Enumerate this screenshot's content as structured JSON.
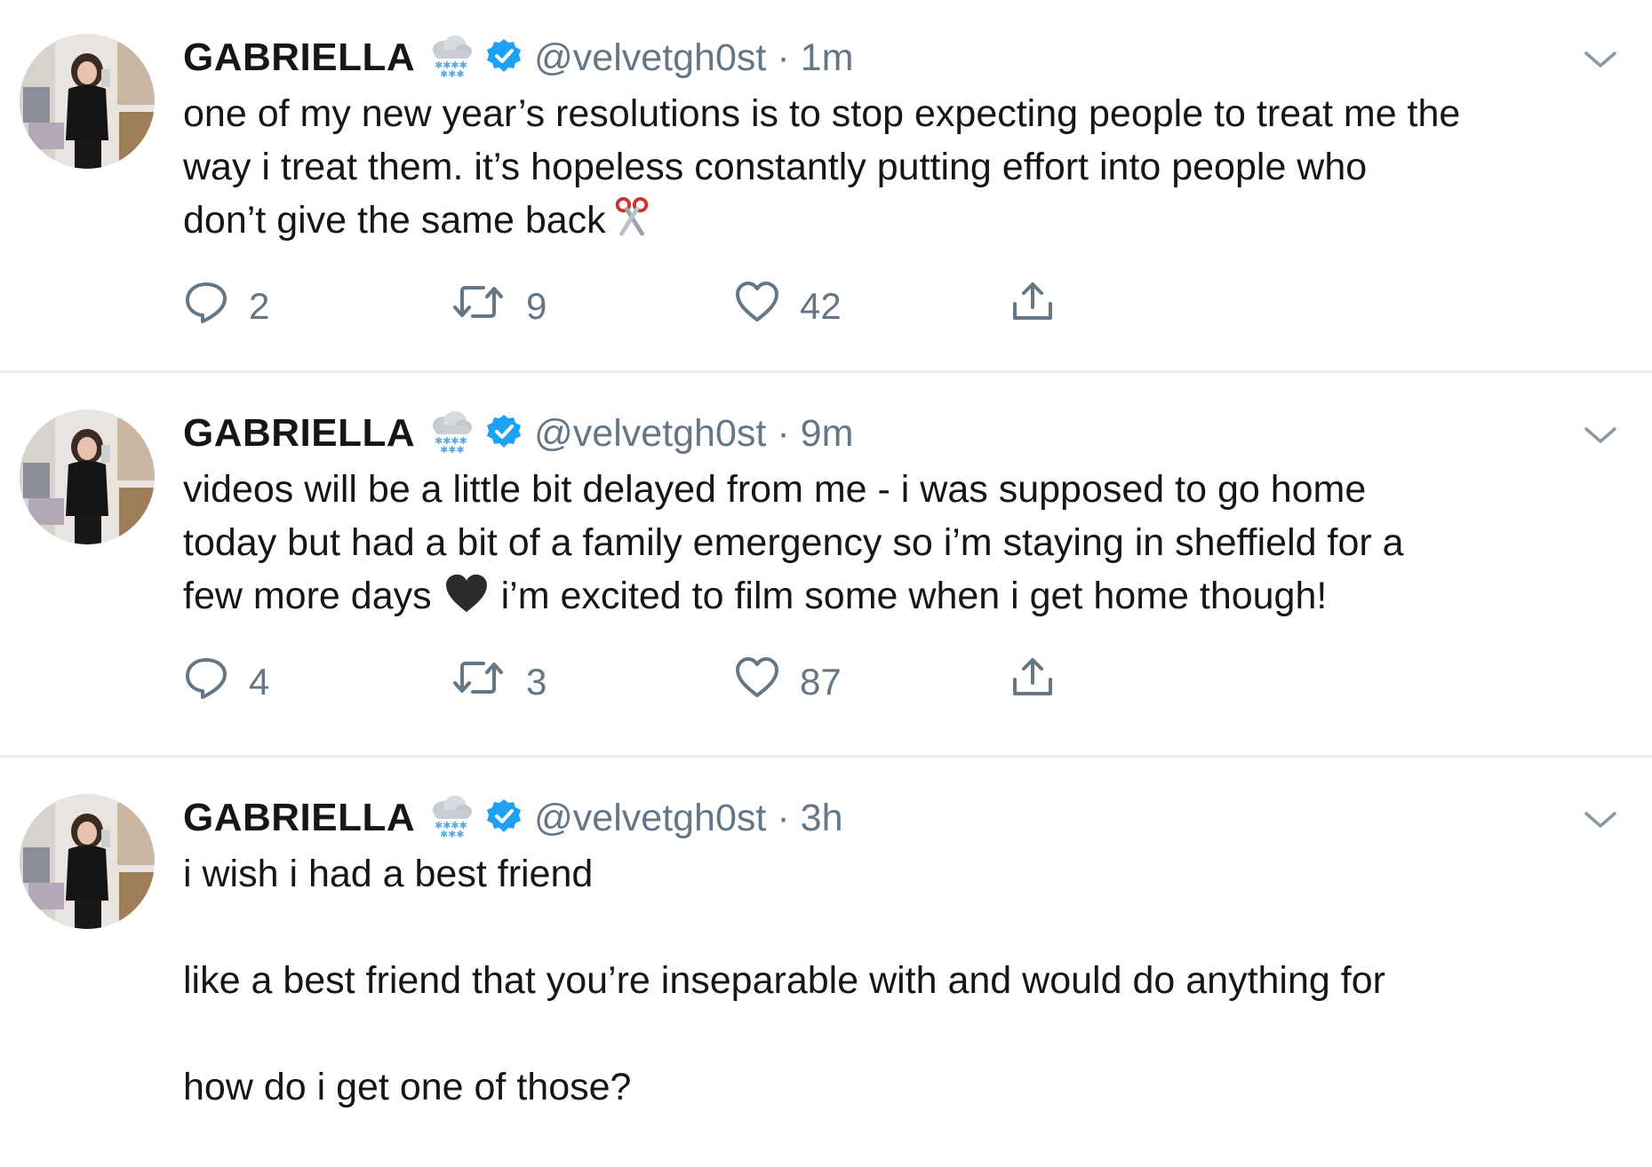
{
  "colors": {
    "text": "#14171a",
    "secondary": "#657786",
    "verified": "#1da1f2",
    "divider": "#e6ecf0"
  },
  "tweets": [
    {
      "name": "GABRIELLA",
      "handle": "@velvetgh0st",
      "separator": "·",
      "time": "1m",
      "text_lines": [
        "one of my new year’s resolutions is to stop expecting people to treat me the",
        "way i treat them. it’s hopeless constantly putting effort into people who",
        "don’t give the same back"
      ],
      "trailing_emoji": "scissors",
      "replies": "2",
      "retweets": "9",
      "likes": "42"
    },
    {
      "name": "GABRIELLA",
      "handle": "@velvetgh0st",
      "separator": "·",
      "time": "9m",
      "text_lines": [
        "videos will be a little bit delayed from me - i was supposed to go home",
        "today but had a bit of a family emergency so i’m staying in sheffield for a",
        "few more days",
        "i’m excited to film some when i get home though!"
      ],
      "inline_emoji": "black-heart",
      "replies": "4",
      "retweets": "3",
      "likes": "87"
    },
    {
      "name": "GABRIELLA",
      "handle": "@velvetgh0st",
      "separator": "·",
      "time": "3h",
      "paragraphs": [
        "i wish i had a best friend",
        "like a best friend that you’re inseparable with and would do anything for",
        "how do i get one of those?"
      ]
    }
  ]
}
